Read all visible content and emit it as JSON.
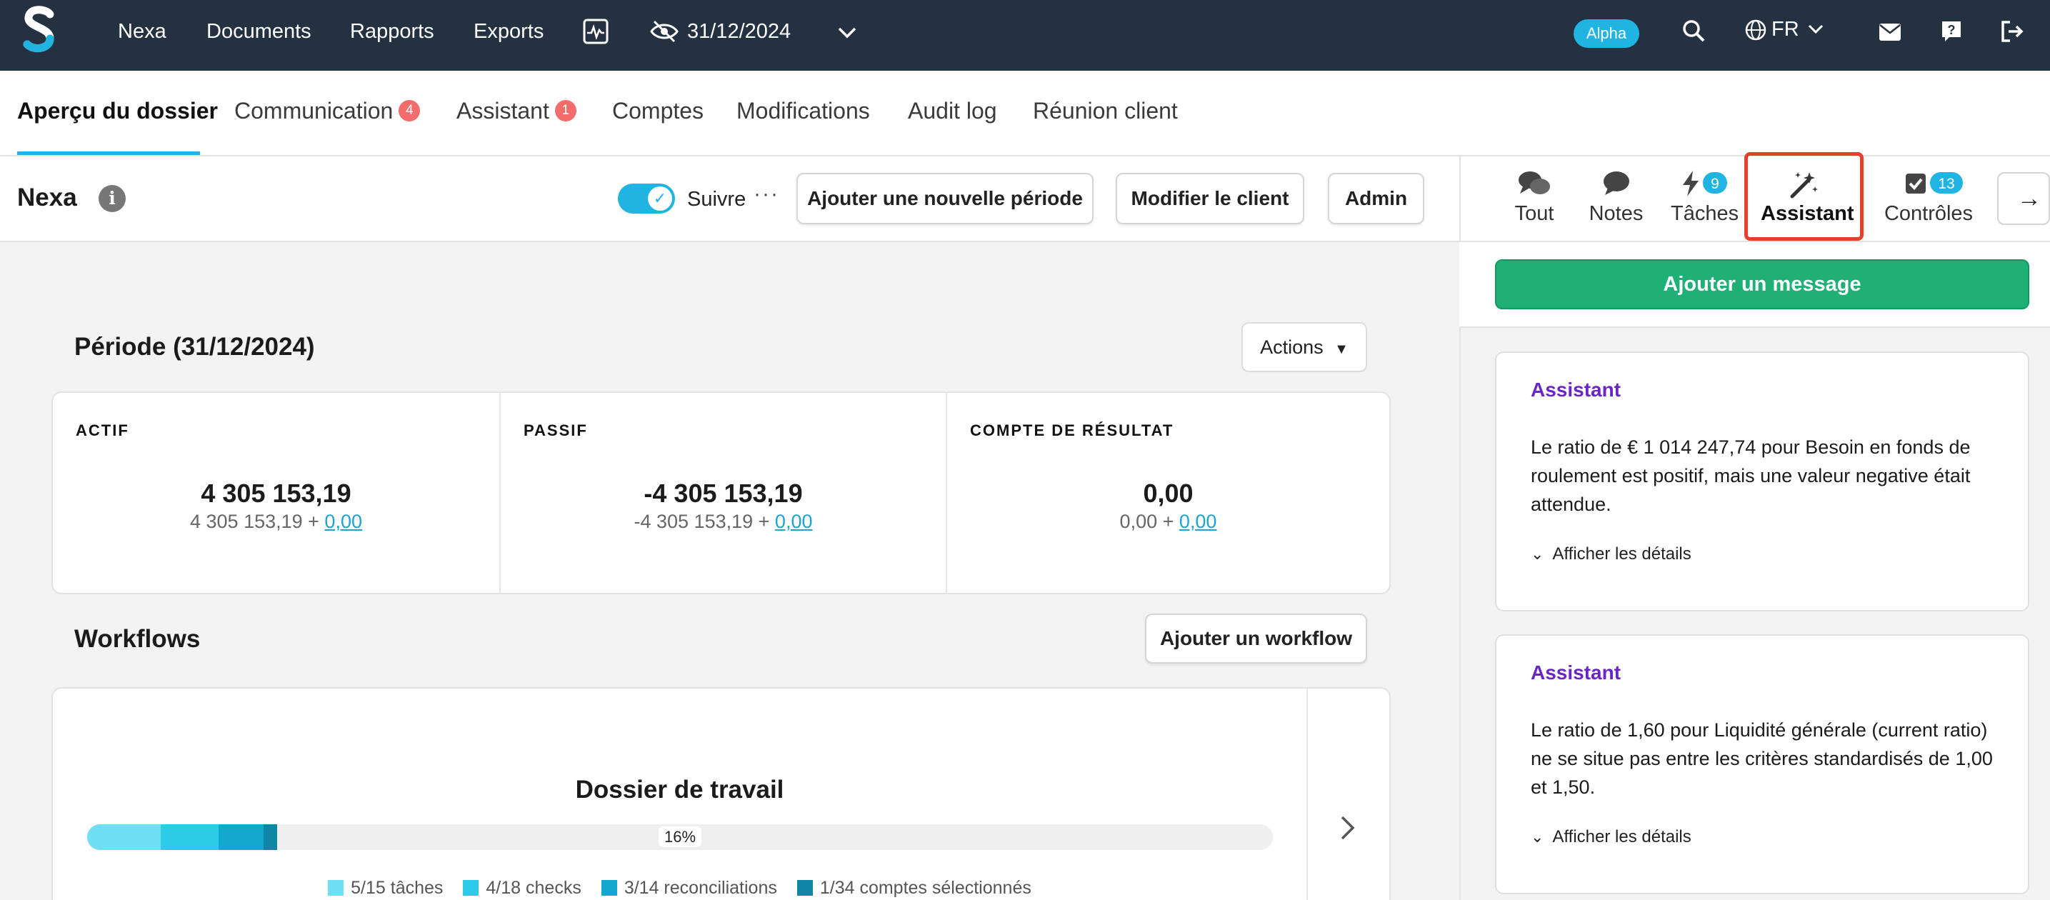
{
  "topbar": {
    "nav": [
      "Nexa",
      "Documents",
      "Rapports",
      "Exports"
    ],
    "date": "31/12/2024",
    "alpha": "Alpha",
    "lang": "FR"
  },
  "tabs": {
    "overview": "Aperçu du dossier",
    "communication": "Communication",
    "communication_count": "4",
    "assistant": "Assistant",
    "assistant_count": "1",
    "accounts": "Comptes",
    "modifications": "Modifications",
    "audit": "Audit log",
    "meeting": "Réunion client"
  },
  "client": {
    "name": "Nexa",
    "info": "i",
    "follow": "Suivre",
    "more": "···",
    "add_period": "Ajouter une nouvelle période",
    "edit_client": "Modifier le client",
    "admin": "Admin"
  },
  "period": {
    "title": "Période (31/12/2024)",
    "actions": "Actions",
    "columns": [
      {
        "label": "ACTIF",
        "value": "4 305 153,19",
        "sub": "4 305 153,19 + ",
        "link": "0,00"
      },
      {
        "label": "PASSIF",
        "value": "-4 305 153,19",
        "sub": "-4 305 153,19 + ",
        "link": "0,00"
      },
      {
        "label": "COMPTE DE RÉSULTAT",
        "value": "0,00",
        "sub": "0,00 + ",
        "link": "0,00"
      }
    ]
  },
  "workflows": {
    "title": "Workflows",
    "add": "Ajouter un workflow",
    "card_title": "Dossier de travail",
    "progress_pct": "16%",
    "progress_value": 16,
    "segments": [
      {
        "fraction": 0.062,
        "color": "#6fe0f3"
      },
      {
        "fraction": 0.049,
        "color": "#2ccbe8"
      },
      {
        "fraction": 0.038,
        "color": "#12a9cc"
      },
      {
        "fraction": 0.011,
        "color": "#0f86a5"
      }
    ],
    "legend": [
      {
        "label": "5/15 tâches",
        "color": "#6fe0f3"
      },
      {
        "label": "4/18 checks",
        "color": "#2ccbe8"
      },
      {
        "label": "3/14 reconciliations",
        "color": "#12a9cc"
      },
      {
        "label": "1/34 comptes sélectionnés",
        "color": "#0f86a5"
      }
    ]
  },
  "panel": {
    "tabs": {
      "all": "Tout",
      "notes": "Notes",
      "tasks": "Tâches",
      "tasks_count": "9",
      "assistant": "Assistant",
      "controls": "Contrôles",
      "controls_count": "13"
    },
    "add_message": "Ajouter un message",
    "messages": [
      {
        "author": "Assistant",
        "text": "Le ratio de € 1 014 247,74 pour Besoin en fonds de roulement est positif, mais une valeur negative était attendue.",
        "details": "Afficher les détails"
      },
      {
        "author": "Assistant",
        "text": "Le ratio de 1,60 pour Liquidité générale (current ratio) ne se situe pas entre les critères standardisés de 1,00 et 1,50.",
        "details": "Afficher les détails"
      }
    ]
  },
  "colors": {
    "topbar": "#243140",
    "accent": "#1fb4e2",
    "green": "#1fb075",
    "assistant_purple": "#6a25c5",
    "highlight": "#e5402b"
  }
}
